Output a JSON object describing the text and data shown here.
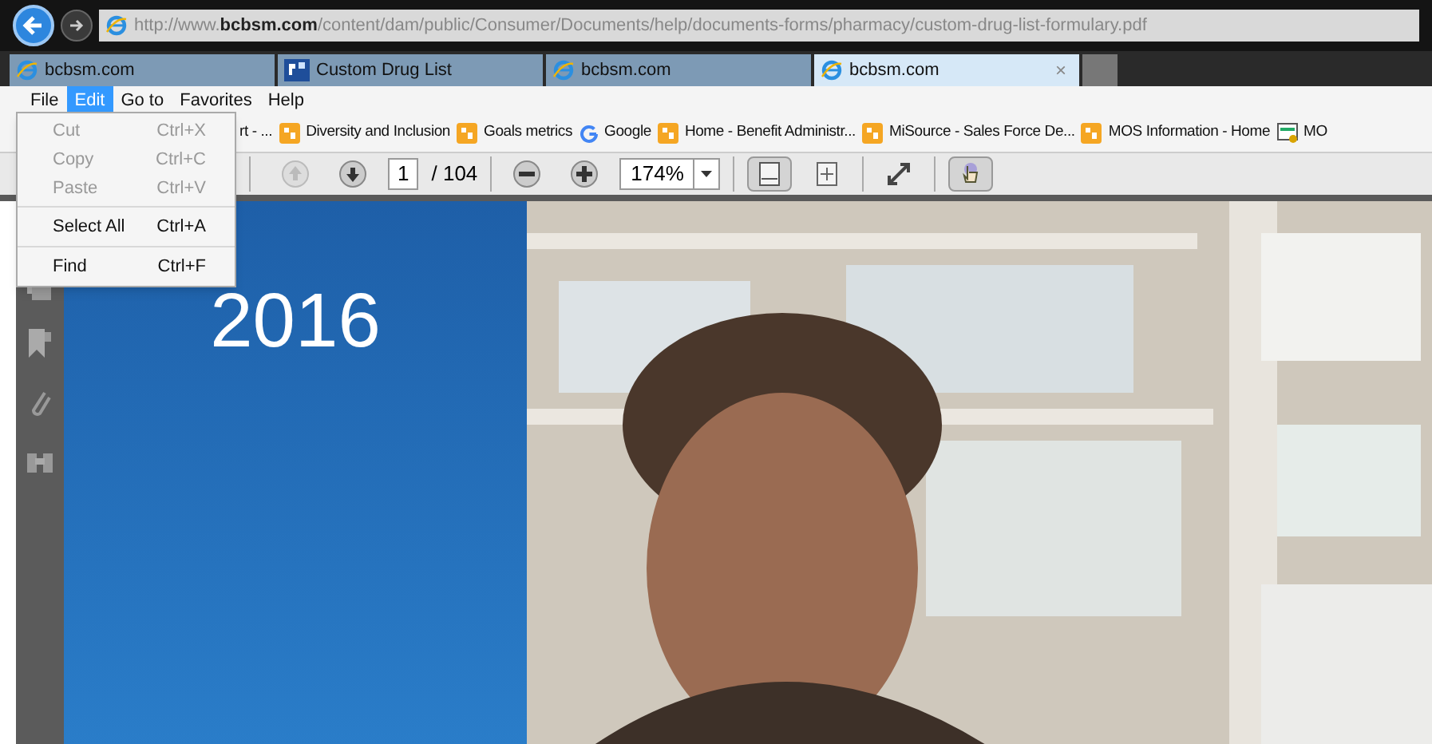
{
  "address_bar": {
    "url_plain_start": "http://www.",
    "url_domain": "bcbsm.com",
    "url_rest": "/content/dam/public/Consumer/Documents/help/documents-forms/pharmacy/custom-drug-list-formulary.pdf"
  },
  "tabs": [
    {
      "label": "bcbsm.com",
      "selected": false
    },
    {
      "label": "Custom Drug List",
      "selected": false
    },
    {
      "label": "bcbsm.com",
      "selected": false
    },
    {
      "label": "bcbsm.com",
      "selected": true,
      "close": "×"
    }
  ],
  "menu_bar": [
    {
      "label": "File",
      "selected": false
    },
    {
      "label": "Edit",
      "selected": true
    },
    {
      "label": "Go to",
      "selected": false
    },
    {
      "label": "Favorites",
      "selected": false
    },
    {
      "label": "Help",
      "selected": false
    }
  ],
  "edit_menu": [
    {
      "label": "Cut",
      "shortcut": "Ctrl+X",
      "disabled": true,
      "separator_before": false
    },
    {
      "label": "Copy",
      "shortcut": "Ctrl+C",
      "disabled": true,
      "separator_before": false
    },
    {
      "label": "Paste",
      "shortcut": "Ctrl+V",
      "disabled": true,
      "separator_before": false
    },
    {
      "label": "Select All",
      "shortcut": "Ctrl+A",
      "disabled": false,
      "separator_before": true
    },
    {
      "label": "Find",
      "shortcut": "Ctrl+F",
      "disabled": false,
      "separator_before": true
    }
  ],
  "favorites": [
    {
      "label": "rt - ...",
      "kind": "text"
    },
    {
      "label": "Diversity and Inclusion",
      "kind": "site"
    },
    {
      "label": "Goals metrics",
      "kind": "site"
    },
    {
      "label": "Google",
      "kind": "google"
    },
    {
      "label": "Home - Benefit Administr...",
      "kind": "site"
    },
    {
      "label": "MiSource - Sales Force De...",
      "kind": "site"
    },
    {
      "label": "MOS Information - Home",
      "kind": "site"
    },
    {
      "label": "MO",
      "kind": "app"
    }
  ],
  "pdf_toolbar": {
    "page": "1",
    "page_total": "/ 104",
    "zoom": "174%"
  },
  "document": {
    "year": "2016"
  }
}
